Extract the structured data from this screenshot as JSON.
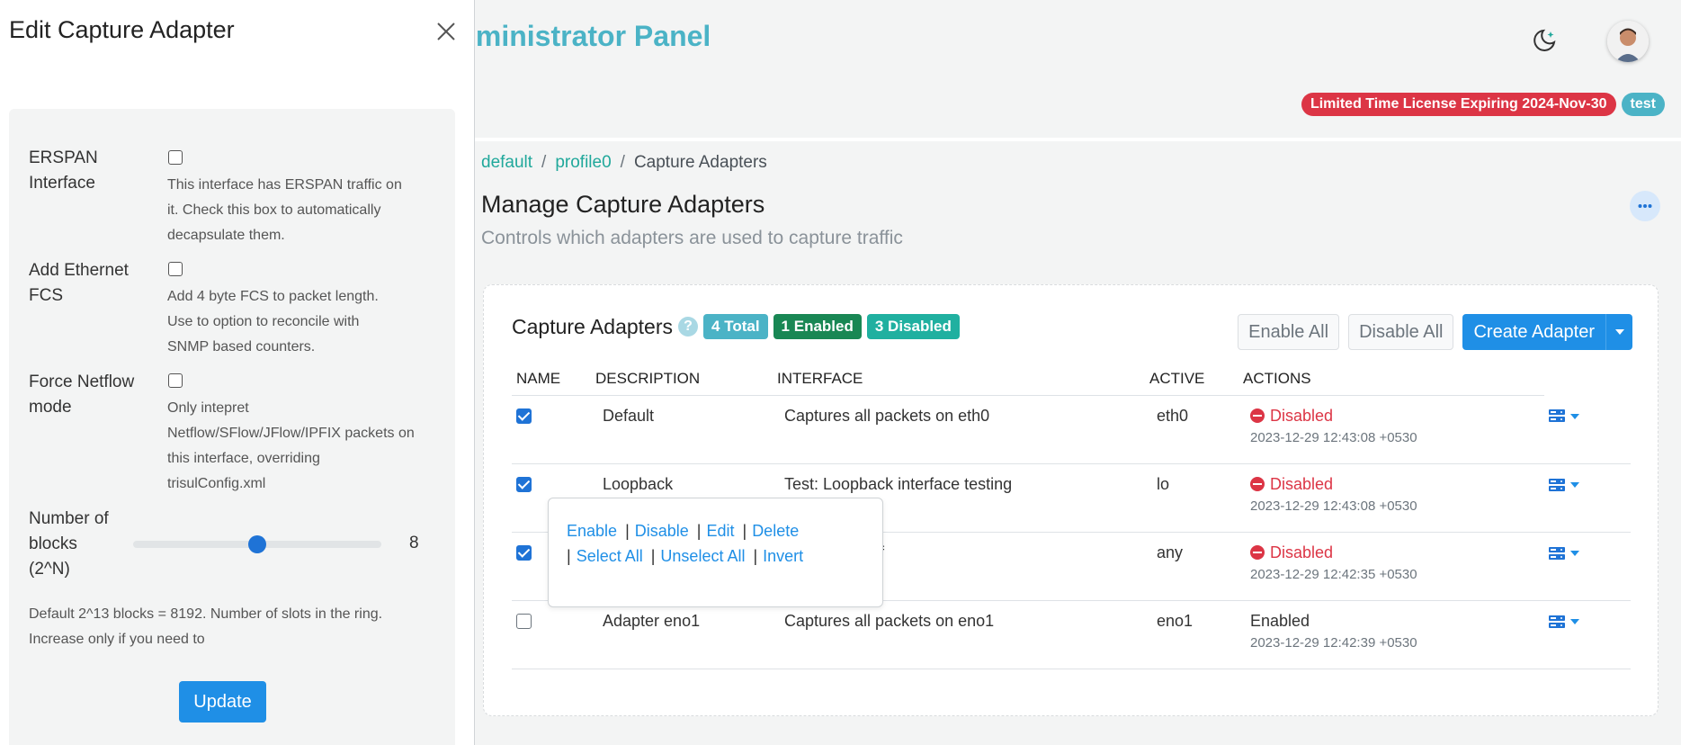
{
  "header": {
    "app_title": "lministrator Panel",
    "license_badge": "Limited Time License Expiring 2024-Nov-30",
    "user_badge": "test"
  },
  "breadcrumb": [
    "default",
    "profile0",
    "Capture Adapters"
  ],
  "page": {
    "title": "Manage Capture Adapters",
    "subtitle": "Controls which adapters are used to capture traffic"
  },
  "card": {
    "title": "Capture Adapters",
    "counts": {
      "total": "4 Total",
      "enabled": "1 Enabled",
      "disabled": "3 Disabled"
    },
    "buttons": {
      "enable_all": "Enable All",
      "disable_all": "Disable All",
      "create": "Create Adapter"
    },
    "columns": [
      "NAME",
      "DESCRIPTION",
      "INTERFACE",
      "ACTIVE",
      "ACTIONS"
    ],
    "rows": [
      {
        "checked": true,
        "name": "Default",
        "description": "Captures all packets on eth0",
        "interface": "eth0",
        "status": "Disabled",
        "timestamp": "2023-12-29 12:43:08 +0530"
      },
      {
        "checked": true,
        "name": "Loopback",
        "description": "Test: Loopback interface testing",
        "interface": "lo",
        "status": "Disabled",
        "timestamp": "2023-12-29 12:43:08 +0530"
      },
      {
        "checked": true,
        "name": "",
        "description": "inux for all intf",
        "interface": "any",
        "status": "Disabled",
        "timestamp": "2023-12-29 12:42:35 +0530"
      },
      {
        "checked": false,
        "name": "Adapter eno1",
        "description": "Captures all packets on eno1",
        "interface": "eno1",
        "status": "Enabled",
        "timestamp": "2023-12-29 12:42:39 +0530"
      }
    ]
  },
  "popover": {
    "line1": [
      "Enable",
      "Disable",
      "Edit",
      "Delete"
    ],
    "line2": [
      "Select All",
      "Unselect All",
      "Invert"
    ]
  },
  "panel": {
    "title": "Edit Capture Adapter",
    "erspan": {
      "label": "ERSPAN Interface",
      "help": "This interface has ERSPAN traffic on it. Check this box to automatically decapsulate them."
    },
    "fcs": {
      "label": "Add Ethernet FCS",
      "help": "Add 4 byte FCS to packet length. Use to option to reconcile with SNMP based counters."
    },
    "netflow": {
      "label": "Force Netflow mode",
      "help": "Only intepret Netflow/SFlow/JFlow/IPFIX packets on this interface, overriding trisulConfig.xml"
    },
    "blocks": {
      "label": "Number of blocks (2^N)",
      "value": "8",
      "min": 0,
      "max": 16,
      "help": "Default 2^13 blocks = 8192. Number of slots in the ring. Increase only if you need to"
    },
    "update_label": "Update"
  },
  "colors": {
    "accent": "#1f8fe6",
    "teal": "#4bb3c6",
    "danger": "#dc3545",
    "success": "#198754"
  }
}
